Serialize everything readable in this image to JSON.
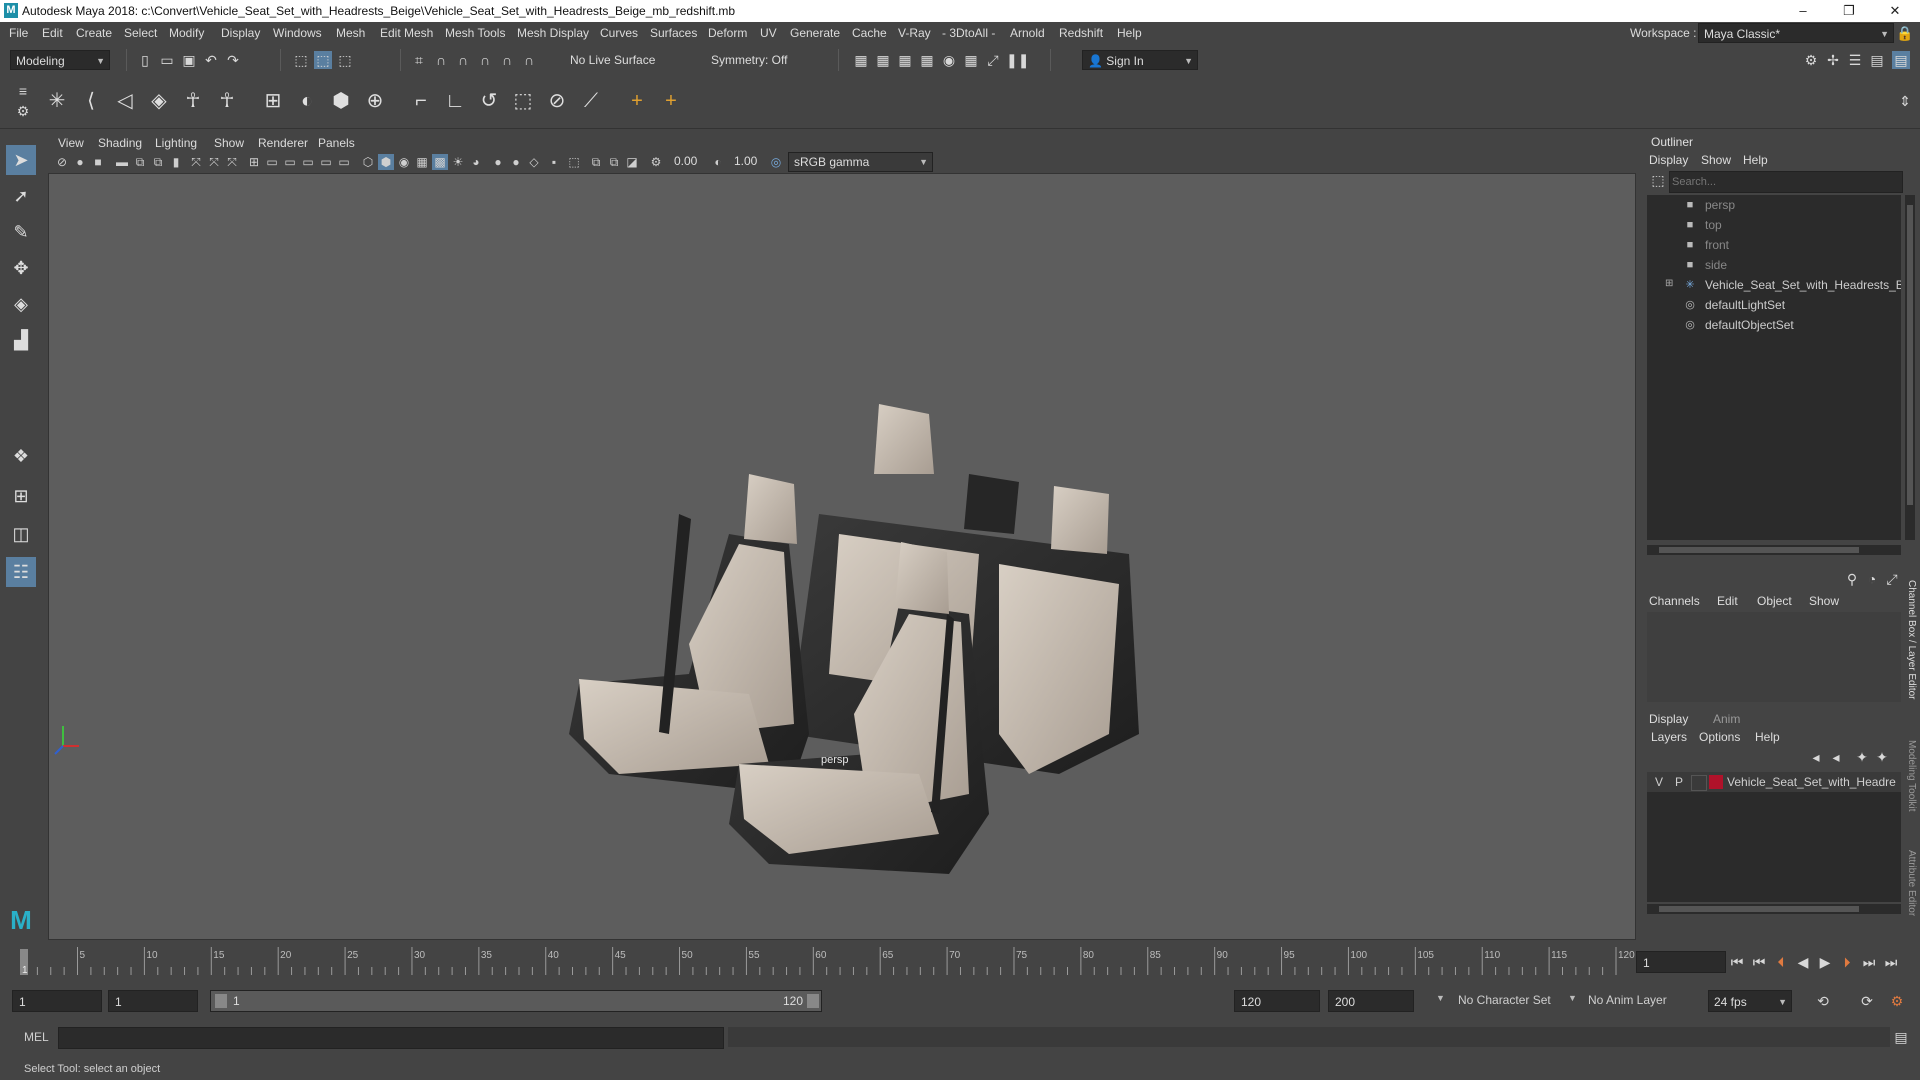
{
  "window": {
    "title": "Autodesk Maya 2018: c:\\Convert\\Vehicle_Seat_Set_with_Headrests_Beige\\Vehicle_Seat_Set_with_Headrests_Beige_mb_redshift.mb",
    "logo": "M",
    "minimize": "–",
    "maximize": "❐",
    "close": "✕"
  },
  "menubar": {
    "items": [
      "File",
      "Edit",
      "Create",
      "Select",
      "Modify",
      "Display",
      "Windows",
      "Mesh",
      "Edit Mesh",
      "Mesh Tools",
      "Mesh Display",
      "Curves",
      "Surfaces",
      "Deform",
      "UV",
      "Generate",
      "Cache",
      "V-Ray",
      "- 3DtoAll -",
      "Arnold",
      "Redshift",
      "Help"
    ],
    "workspace_label": "Workspace :",
    "workspace_value": "Maya Classic*"
  },
  "statusline": {
    "mode": "Modeling",
    "live_surface": "No Live Surface",
    "symmetry": "Symmetry: Off",
    "sign_in": "Sign In"
  },
  "viewport": {
    "menus": [
      "View",
      "Shading",
      "Lighting",
      "Show",
      "Renderer",
      "Panels"
    ],
    "exposure": "0.00",
    "gamma": "1.00",
    "color_space": "sRGB gamma",
    "camera_label": "persp",
    "accent_color": "#7ad"
  },
  "outliner": {
    "title": "Outliner",
    "menus": [
      "Display",
      "Show",
      "Help"
    ],
    "search_placeholder": "Search...",
    "items": [
      {
        "label": "persp",
        "icon": "camera-icon"
      },
      {
        "label": "top",
        "icon": "camera-icon"
      },
      {
        "label": "front",
        "icon": "camera-icon"
      },
      {
        "label": "side",
        "icon": "camera-icon"
      },
      {
        "label": "Vehicle_Seat_Set_with_Headrests_Beige",
        "icon": "group-icon"
      },
      {
        "label": "defaultLightSet",
        "icon": "set-icon"
      },
      {
        "label": "defaultObjectSet",
        "icon": "set-icon"
      }
    ]
  },
  "channelbox": {
    "menus": [
      "Channels",
      "Edit",
      "Object",
      "Show"
    ],
    "side_tab_1": "Channel Box / Layer Editor",
    "side_tab_2": "Modeling Toolkit",
    "side_tab_3": "Attribute Editor"
  },
  "layers": {
    "tabs": [
      "Display",
      "Anim"
    ],
    "menus": [
      "Layers",
      "Options",
      "Help"
    ],
    "layer": {
      "v": "V",
      "p": "P",
      "name": "Vehicle_Seat_Set_with_Headre",
      "color": "#b0122a"
    }
  },
  "timeline": {
    "ticks": [
      "1",
      "5",
      "10",
      "15",
      "20",
      "25",
      "30",
      "35",
      "40",
      "45",
      "50",
      "55",
      "60",
      "65",
      "70",
      "75",
      "80",
      "85",
      "90",
      "95",
      "100",
      "105",
      "110",
      "115",
      "120"
    ],
    "current_frame": "1"
  },
  "range": {
    "start": "1",
    "playback_start": "1",
    "slider_start": "1",
    "slider_end": "120",
    "playback_end": "120",
    "end": "200",
    "character_set": "No Character Set",
    "anim_layer": "No Anim Layer",
    "fps": "24 fps"
  },
  "cmdline": {
    "label": "MEL"
  },
  "helpline": {
    "text": "Select Tool: select an object"
  }
}
